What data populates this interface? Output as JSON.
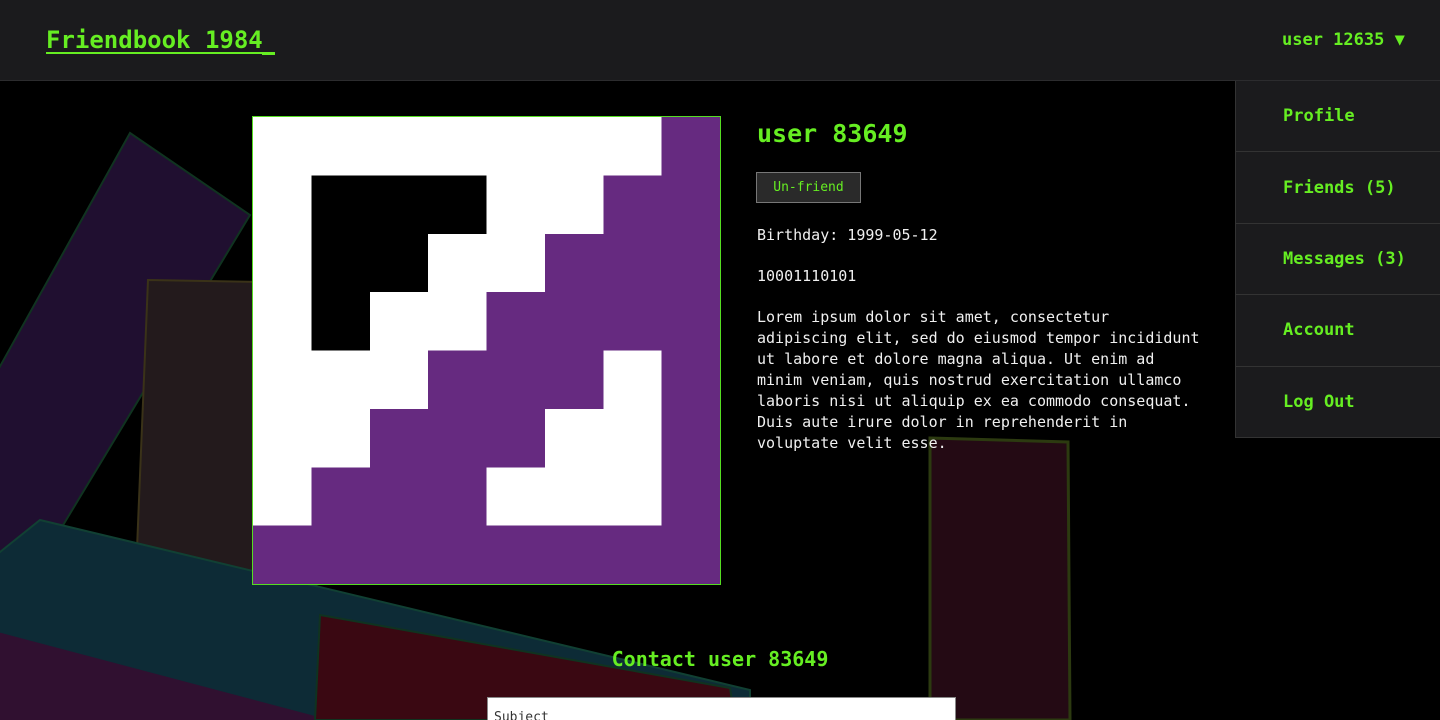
{
  "header": {
    "brand": "Friendbook 1984",
    "user_menu_label": "user 12635 ▼"
  },
  "user_menu": {
    "items": [
      {
        "label": "Profile"
      },
      {
        "label": "Friends (5)"
      },
      {
        "label": "Messages (3)"
      },
      {
        "label": "Account"
      },
      {
        "label": "Log Out"
      }
    ]
  },
  "profile": {
    "name": "user 83649",
    "unfriend_label": "Un-friend",
    "birthday": "Birthday: 1999-05-12",
    "binary": "10001110101",
    "bio": "Lorem ipsum dolor sit amet, consectetur adipiscing elit, sed do eiusmod tempor incididunt ut labore et dolore magna aliqua. Ut enim ad minim veniam, quis nostrud exercitation ullamco laboris nisi ut aliquip ex ea commodo consequat. Duis aute irure dolor in reprehenderit in voluptate velit esse."
  },
  "contact": {
    "heading": "Contact user 83649",
    "subject_placeholder": "Subject"
  },
  "colors": {
    "accent": "#66ee22",
    "avatar_purple": "#662a80",
    "avatar_black": "#000000",
    "avatar_white": "#ffffff",
    "topbar": "#1b1b1d"
  }
}
